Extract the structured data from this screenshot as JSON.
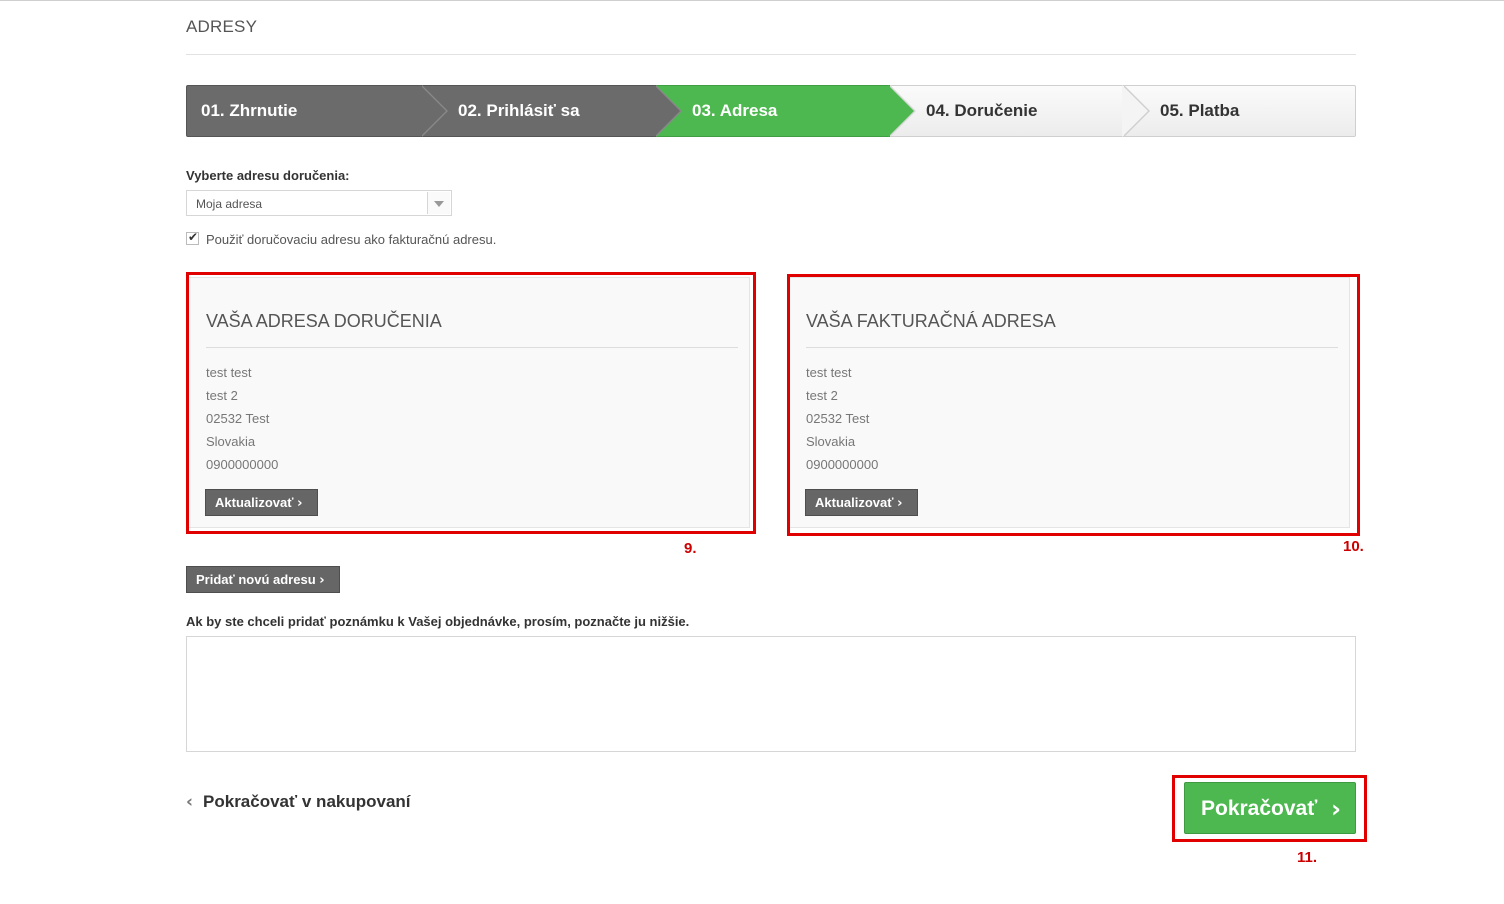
{
  "page": {
    "title": "ADRESY"
  },
  "steps": [
    {
      "label": "01. Zhrnutie",
      "state": "done"
    },
    {
      "label": "02. Prihlásiť sa",
      "state": "done"
    },
    {
      "label": "03. Adresa",
      "state": "active"
    },
    {
      "label": "04. Doručenie",
      "state": "todo"
    },
    {
      "label": "05. Platba",
      "state": "todo"
    }
  ],
  "delivery_select": {
    "label": "Vyberte adresu doručenia:",
    "value": "Moja adresa"
  },
  "same_address": {
    "label": "Použiť doručovaciu adresu ako fakturačnú adresu.",
    "checked": true
  },
  "delivery_address": {
    "title": "VAŠA ADRESA DORUČENIA",
    "lines": [
      "test test",
      "test 2",
      "02532 Test",
      "Slovakia",
      "0900000000"
    ],
    "update_label": "Aktualizovať"
  },
  "billing_address": {
    "title": "VAŠA FAKTURAČNÁ ADRESA",
    "lines": [
      "test test",
      "test 2",
      "02532 Test",
      "Slovakia",
      "0900000000"
    ],
    "update_label": "Aktualizovať"
  },
  "add_address": {
    "label": "Pridať novú adresu"
  },
  "note": {
    "label": "Ak by ste chceli pridať poznámku k Vašej objednávke, prosím, poznačte ju nižšie.",
    "value": ""
  },
  "back_link": {
    "label": "Pokračovať v nakupovaní"
  },
  "continue": {
    "label": "Pokračovať"
  },
  "annotations": {
    "delivery": "9.",
    "billing": "10.",
    "continue": "11."
  },
  "colors": {
    "active_step": "#4cb84f",
    "done_step": "#6b6b6b",
    "annotation": "#e00000"
  },
  "icons": {
    "chevron": "chevron-right-icon",
    "back": "chevron-left-icon",
    "dropdown": "caret-down-icon",
    "check": "check-icon"
  }
}
